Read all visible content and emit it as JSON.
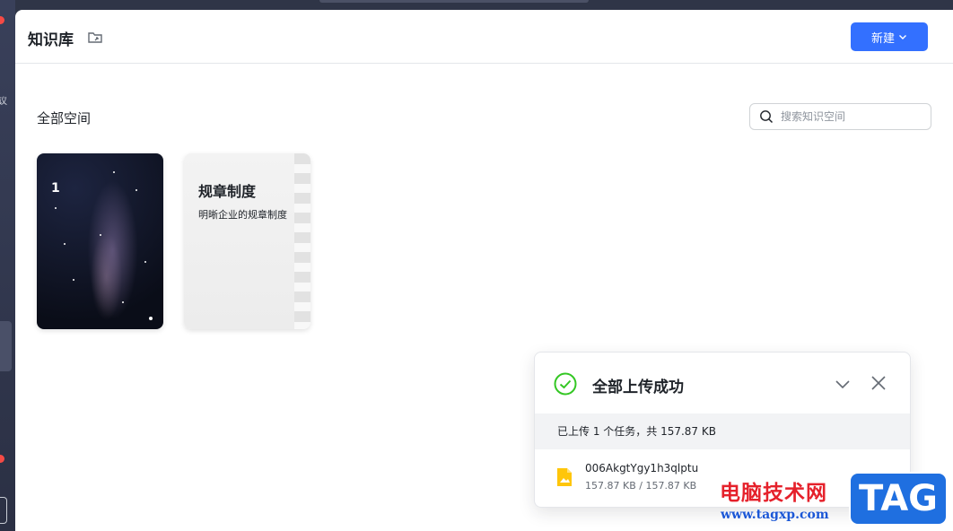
{
  "header": {
    "title": "知识库",
    "new_button_label": "新建"
  },
  "section": {
    "title": "全部空间"
  },
  "search": {
    "placeholder": "搜索知识空间"
  },
  "spaces": [
    {
      "title": "1",
      "description": ""
    },
    {
      "title": "规章制度",
      "description": "明晰企业的规章制度"
    }
  ],
  "upload_toast": {
    "title": "全部上传成功",
    "summary": "已上传 1 个任务，共 157.87 KB",
    "file_name": "006AkgtYgy1h3qlptu",
    "file_progress": "157.87 KB / 157.87 KB"
  },
  "watermark": {
    "text": "电脑技术网",
    "url": "www.tagxp.com",
    "tag": "TAG"
  },
  "colors": {
    "accent": "#3370ff",
    "success": "#34c724",
    "file_icon": "#ffc60a"
  },
  "icons": {
    "title_icon": "folder-share-icon",
    "search_icon": "search-icon",
    "new_dropdown": "chevron-down-icon",
    "success": "check-circle-icon",
    "collapse": "chevron-down-icon",
    "close": "close-icon",
    "file": "image-file-icon"
  }
}
